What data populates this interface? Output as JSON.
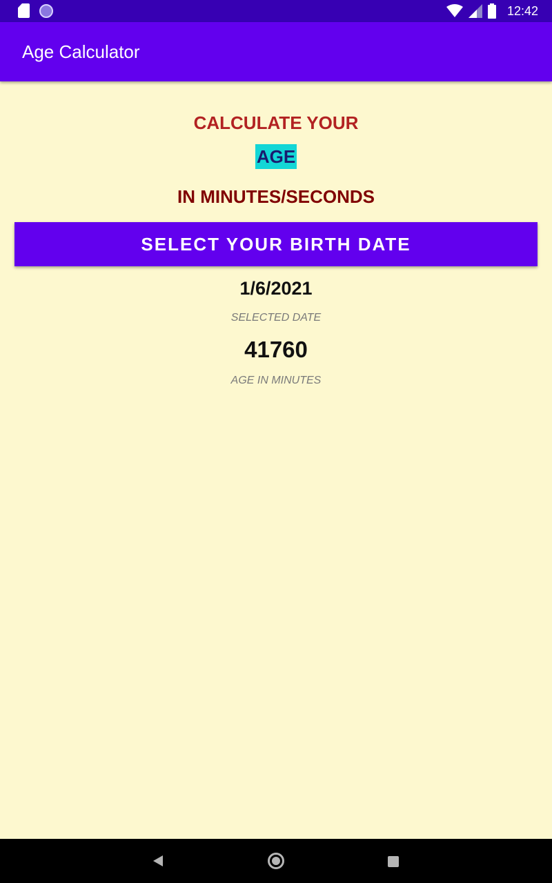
{
  "status_bar": {
    "time": "12:42",
    "icons": [
      "sd-card-icon",
      "circle-notification-icon",
      "wifi-icon",
      "cell-signal-icon",
      "battery-icon"
    ]
  },
  "app_bar": {
    "title": "Age Calculator",
    "color": "#6200ee"
  },
  "heading": {
    "line1": "CALCULATE YOUR",
    "highlight": "AGE",
    "line3": "IN MINUTES/SECONDS"
  },
  "select_button": {
    "label": "SELECT YOUR BIRTH DATE"
  },
  "result": {
    "selected_date": "1/6/2021",
    "selected_date_caption": "SELECTED DATE",
    "age_in_minutes": "41760",
    "age_in_minutes_caption": "AGE IN MINUTES"
  },
  "nav_bar": {
    "buttons": [
      "back-icon",
      "home-icon",
      "recents-icon"
    ]
  }
}
